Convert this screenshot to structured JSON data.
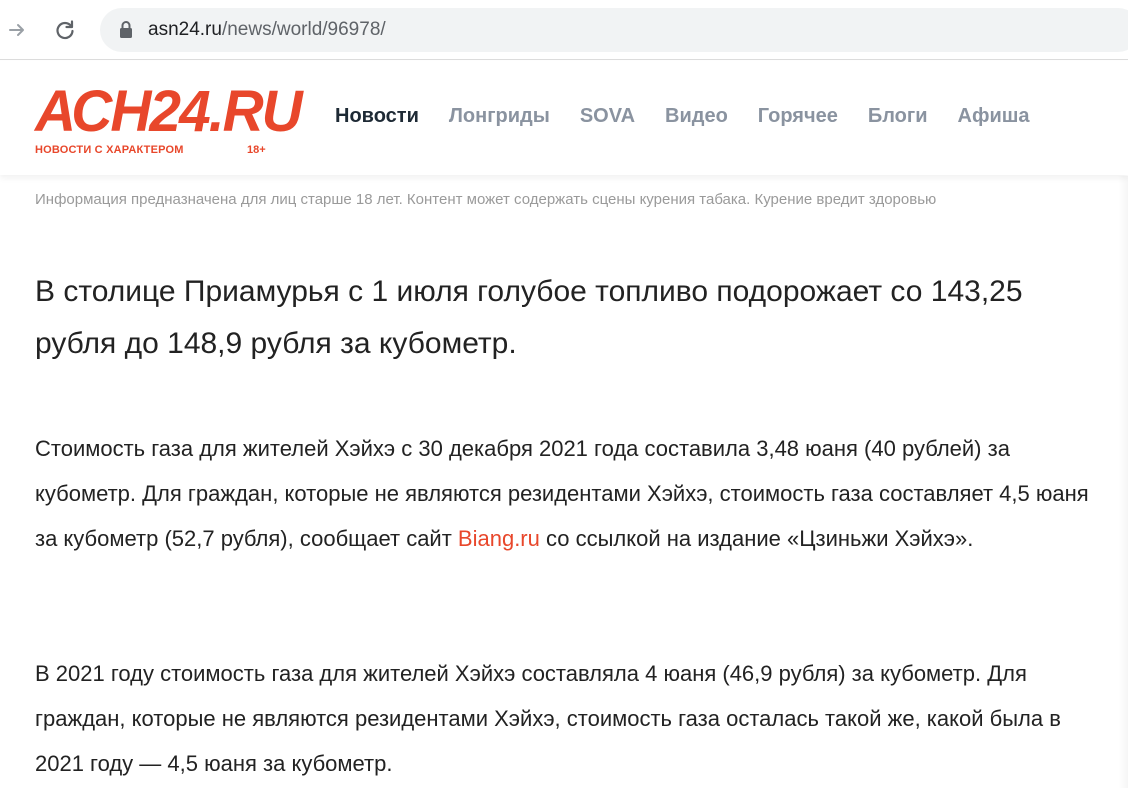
{
  "browser": {
    "url_host": "asn24.ru",
    "url_path": "/news/world/96978/"
  },
  "site": {
    "logo_text": "АСН24.RU",
    "logo_tagline": "НОВОСТИ С ХАРАКТЕРОМ",
    "age_rating": "18+",
    "menu": [
      {
        "label": "Новости",
        "active": true
      },
      {
        "label": "Лонгриды",
        "active": false
      },
      {
        "label": "SOVA",
        "active": false
      },
      {
        "label": "Видео",
        "active": false
      },
      {
        "label": "Горячее",
        "active": false
      },
      {
        "label": "Блоги",
        "active": false
      },
      {
        "label": "Афиша",
        "active": false
      }
    ]
  },
  "article": {
    "disclaimer": "Информация предназначена для лиц старше 18 лет. Контент может содержать сцены курения табака. Курение вредит здоровью",
    "headline": "В столице Приамурья с 1 июля голубое топливо подорожает со 143,25 рубля до 148,9 рубля за кубометр.",
    "para1_before_link": "Стоимость газа для жителей Хэйхэ с 30 декабря 2021 года составила 3,48 юаня (40 рублей) за кубометр. Для граждан, которые не являются резидентами Хэйхэ, стоимость газа составляет 4,5 юаня за кубометр (52,7 рубля), сообщает сайт ",
    "para1_link": "Biang.ru",
    "para1_after_link": " со ссылкой на издание «Цзиньжи Хэйхэ».",
    "para2": "В 2021 году стоимость газа для жителей Хэйхэ составляла 4 юаня (46,9 рубля) за кубометр. Для граждан, которые не являются резидентами Хэйхэ, стоимость газа осталась такой же, какой была в 2021 году — 4,5 юаня за кубометр."
  },
  "colors": {
    "brand": "#e8472b",
    "menu_active": "#1e2a35",
    "menu_inactive": "#8a93a0"
  },
  "icons": [
    "forward-arrow-icon",
    "reload-icon",
    "lock-icon"
  ]
}
